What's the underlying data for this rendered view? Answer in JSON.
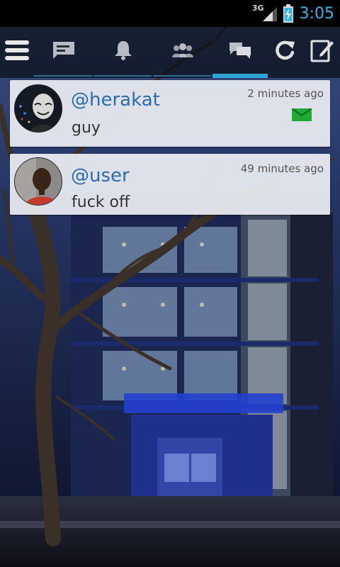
{
  "status_bar": {
    "network": "3G",
    "time": "3:05",
    "clock_color": "#33b5e5"
  },
  "action_bar": {
    "menu_icon": "hamburger-menu-icon",
    "tabs": [
      {
        "icon": "timeline-icon",
        "active": false
      },
      {
        "icon": "bell-icon",
        "active": false
      },
      {
        "icon": "people-icon",
        "active": false
      },
      {
        "icon": "chat-bubbles-icon",
        "active": true
      }
    ],
    "refresh_icon": "refresh-icon",
    "compose_icon": "compose-icon",
    "accent_color": "#2ea3d6"
  },
  "notifications": [
    {
      "handle": "@herakat",
      "message": "guy",
      "timestamp": "2 minutes ago",
      "direct_message": true,
      "avatar_icon": "masked-face-avatar"
    },
    {
      "handle": "@user",
      "message": "fuck off",
      "timestamp": "49 minutes ago",
      "direct_message": false,
      "avatar_icon": "person-avatar"
    }
  ],
  "colors": {
    "handle": "#2b6cb0",
    "dm_badge": "#1faa36"
  }
}
